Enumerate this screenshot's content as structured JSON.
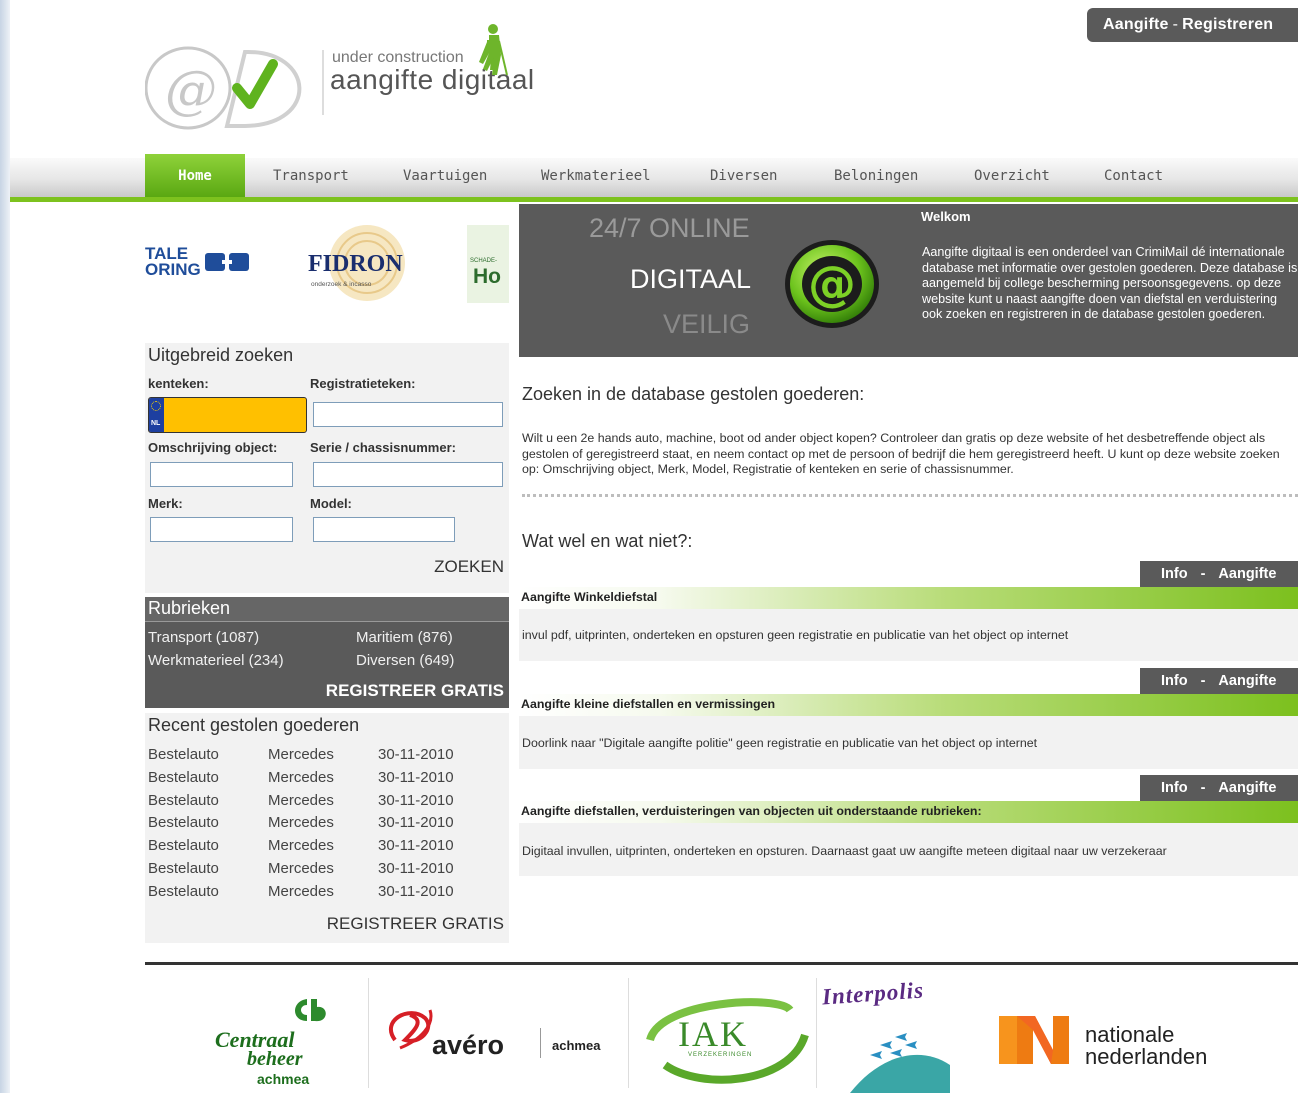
{
  "header": {
    "top_link_aangifte": "Aangifte",
    "top_link_sep": "-",
    "top_link_registreren": "Registreren",
    "logo_tag": "under construction",
    "logo_name": "aangifte digitaal"
  },
  "nav": [
    "Home",
    "Transport",
    "Vaartuigen",
    "Werkmaterieel",
    "Diversen",
    "Beloningen",
    "Overzicht",
    "Contact"
  ],
  "sponsors": {
    "left_partial_top": "TALE",
    "left_partial_bottom": "ORING",
    "fidron": "FIDRON",
    "fidron_sub": "onderzoek & incasso",
    "right_partial_small": "SCHADE-",
    "right_partial": "Ho"
  },
  "search": {
    "title": "Uitgebreid zoeken",
    "kenteken_label": "kenteken:",
    "registratie_label": "Registratieteken:",
    "plate_country": "NL",
    "omschrijving_label": "Omschrijving object:",
    "serie_label": "Serie / chassisnummer:",
    "merk_label": "Merk:",
    "model_label": "Model:",
    "submit": "ZOEKEN"
  },
  "rubrieken": {
    "title": "Rubrieken",
    "items": [
      "Transport (1087)",
      "Maritiem (876)",
      "Werkmaterieel (234)",
      "Diversen (649)"
    ],
    "register": "REGISTREER GRATIS"
  },
  "recent": {
    "title": "Recent gestolen goederen",
    "rows": [
      [
        "Bestelauto",
        "Mercedes",
        "30-11-2010"
      ],
      [
        "Bestelauto",
        "Mercedes",
        "30-11-2010"
      ],
      [
        "Bestelauto",
        "Mercedes",
        "30-11-2010"
      ],
      [
        "Bestelauto",
        "Mercedes",
        "30-11-2010"
      ],
      [
        "Bestelauto",
        "Mercedes",
        "30-11-2010"
      ],
      [
        "Bestelauto",
        "Mercedes",
        "30-11-2010"
      ],
      [
        "Bestelauto",
        "Mercedes",
        "30-11-2010"
      ]
    ],
    "register": "REGISTREER GRATIS"
  },
  "banner": {
    "line1": "24/7 ONLINE",
    "line2": "DIGITAAL",
    "line3": "VEILIG",
    "welcome_title": "Welkom",
    "welcome_text": "Aangifte digitaal is een onderdeel van CrimiMail dé internationale database met informatie over gestolen goederen. Deze database is aangemeld bij college bescherming persoonsgegevens. op deze website kunt u naast aangifte doen van diefstal en verduistering ook zoeken en registreren in de database gestolen goederen."
  },
  "main": {
    "search_title": "Zoeken in de database gestolen goederen:",
    "search_text": "Wilt u een 2e hands auto, machine, boot od ander object kopen? Controleer dan gratis op deze website of het desbetreffende object als gestolen of geregistreerd staat, en neem contact op met de persoon of bedrijf die hem geregistreerd heeft. U kunt op deze website zoeken op: Omschrijving object, Merk, Model, Registratie of kenteken en serie of chassisnummer.",
    "wat_title": "Wat wel en wat niet?:",
    "info": "Info",
    "dash": "-",
    "aangifte": "Aangifte",
    "sections": [
      {
        "title": "Aangifte Winkeldiefstal",
        "text": "invul pdf, uitprinten, onderteken en opsturen geen registratie en publicatie van het object op internet"
      },
      {
        "title": "Aangifte kleine diefstallen en vermissingen",
        "text": "Doorlink naar \"Digitale aangifte politie\" geen registratie en publicatie van het object op internet"
      },
      {
        "title": "Aangifte diefstallen, verduisteringen van objecten uit onderstaande rubrieken:",
        "text": "Digitaal invullen, uitprinten, onderteken en opsturen. Daarnaast gaat uw aangifte meteen digitaal naar uw verzekeraar"
      }
    ]
  },
  "footer_logos": {
    "centraal_line1": "Centraal",
    "centraal_line2": "beheer",
    "centraal_line3": "achmea",
    "avero": "avéro",
    "avero_sub": "achmea",
    "iak": "IAK",
    "iak_sub": "VERZEKERINGEN",
    "interpolis": "Interpolis",
    "nn_line1": "nationale",
    "nn_line2": "nederlanden"
  },
  "colors": {
    "accent_green": "#7dc21e",
    "dark_panel": "#5a5a5a",
    "plate_yellow": "#ffc000"
  }
}
